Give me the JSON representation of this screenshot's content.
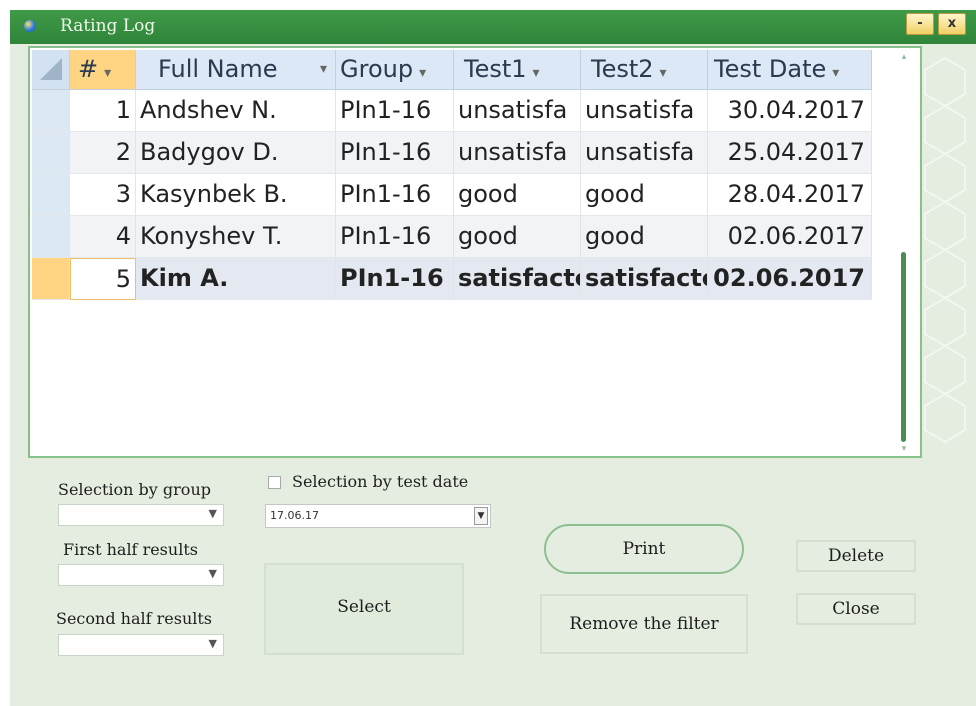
{
  "window": {
    "title": "Rating Log",
    "minimize_label": "-",
    "close_label": "x"
  },
  "grid": {
    "columns": [
      "#",
      "Full Name",
      "Group",
      "Test1",
      "Test2",
      "Test Date"
    ],
    "rows": [
      {
        "num": "1",
        "name": "Andshev N.",
        "group": "PIn1-16",
        "test1": "unsatisfa",
        "test2": "unsatisfa",
        "date": "30.04.2017"
      },
      {
        "num": "2",
        "name": "Badygov D.",
        "group": "PIn1-16",
        "test1": "unsatisfa",
        "test2": "unsatisfa",
        "date": "25.04.2017"
      },
      {
        "num": "3",
        "name": "Kasynbek B.",
        "group": "PIn1-16",
        "test1": "good",
        "test2": "good",
        "date": "28.04.2017"
      },
      {
        "num": "4",
        "name": "Konyshev T.",
        "group": "PIn1-16",
        "test1": "good",
        "test2": "good",
        "date": "02.06.2017"
      },
      {
        "num": "5",
        "name": "Kim A.",
        "group": "PIn1-16",
        "test1": "satisfactc",
        "test2": "satisfactc",
        "date": "02.06.2017"
      }
    ]
  },
  "filters": {
    "group_label": "Selection by group",
    "first_half_label": "First half results",
    "second_half_label": "Second half results",
    "test_date_label": "Selection by test date",
    "test_date_value": "17.06.17"
  },
  "buttons": {
    "select": "Select",
    "print": "Print",
    "remove_filter": "Remove the filter",
    "delete": "Delete",
    "close": "Close"
  }
}
